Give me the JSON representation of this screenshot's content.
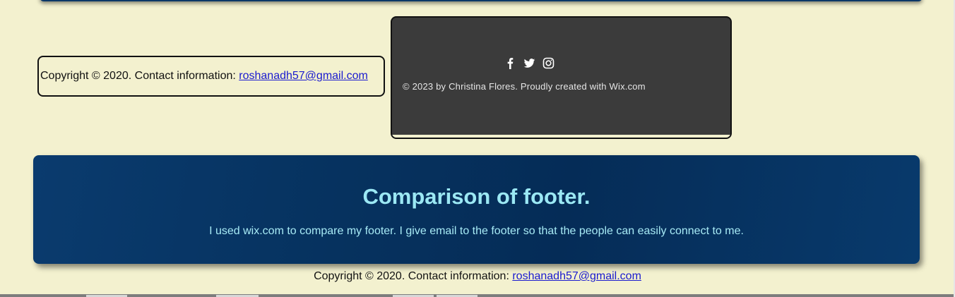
{
  "my_footer": {
    "prefix": "Copyright © 2020. Contact information: ",
    "email": "roshanadh57@gmail.com"
  },
  "wix_footer": {
    "social_icons": [
      "facebook-icon",
      "twitter-icon",
      "instagram-icon"
    ],
    "credit": "© 2023 by Christina Flores. Proudly created with Wix.com"
  },
  "comparison": {
    "title": "Comparison of footer.",
    "description": "I used wix.com to compare my footer. I give email to the footer so that the people can easily connect to me."
  },
  "page_footer": {
    "prefix": "Copyright © 2020. Contact information: ",
    "email": "roshanadh57@gmail.com"
  },
  "colors": {
    "page_background": "#f3f1cf",
    "comparison_background": "#06325f",
    "comparison_text": "#9be8f4",
    "wix_footer_background": "#3b3b3b",
    "link": "#1a1acf"
  }
}
